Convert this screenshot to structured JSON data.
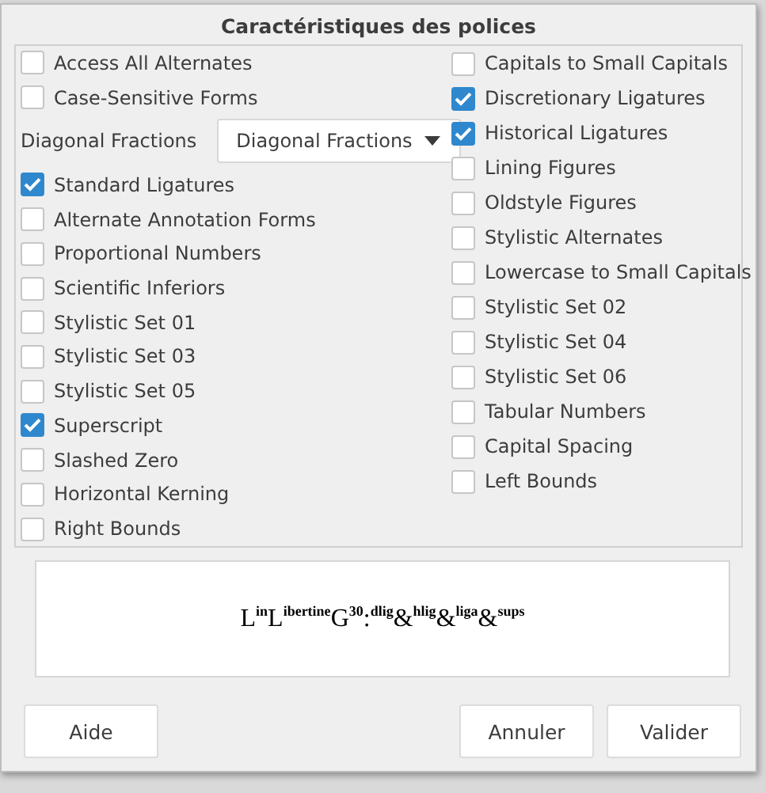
{
  "dialog": {
    "title": "Caractéristiques des polices"
  },
  "left_column": [
    {
      "kind": "checkbox",
      "label": "Access All Alternates",
      "checked": false
    },
    {
      "kind": "checkbox",
      "label": "Case-Sensitive Forms",
      "checked": false
    },
    {
      "kind": "dropdown",
      "label": "Diagonal Fractions",
      "value": "Diagonal Fractions"
    },
    {
      "kind": "checkbox",
      "label": "Standard Ligatures",
      "checked": true
    },
    {
      "kind": "checkbox",
      "label": "Alternate Annotation Forms",
      "checked": false
    },
    {
      "kind": "checkbox",
      "label": "Proportional Numbers",
      "checked": false
    },
    {
      "kind": "checkbox",
      "label": "Scientific Inferiors",
      "checked": false
    },
    {
      "kind": "checkbox",
      "label": "Stylistic Set 01",
      "checked": false
    },
    {
      "kind": "checkbox",
      "label": "Stylistic Set 03",
      "checked": false
    },
    {
      "kind": "checkbox",
      "label": "Stylistic Set 05",
      "checked": false
    },
    {
      "kind": "checkbox",
      "label": "Superscript",
      "checked": true
    },
    {
      "kind": "checkbox",
      "label": "Slashed Zero",
      "checked": false
    },
    {
      "kind": "checkbox",
      "label": "Horizontal Kerning",
      "checked": false
    },
    {
      "kind": "checkbox",
      "label": "Right Bounds",
      "checked": false
    }
  ],
  "right_column": [
    {
      "kind": "checkbox",
      "label": "Capitals to Small Capitals",
      "checked": false
    },
    {
      "kind": "checkbox",
      "label": "Discretionary Ligatures",
      "checked": true
    },
    {
      "kind": "checkbox",
      "label": "Historical Ligatures",
      "checked": true
    },
    {
      "kind": "checkbox",
      "label": "Lining Figures",
      "checked": false
    },
    {
      "kind": "checkbox",
      "label": "Oldstyle Figures",
      "checked": false
    },
    {
      "kind": "checkbox",
      "label": "Stylistic Alternates",
      "checked": false
    },
    {
      "kind": "checkbox",
      "label": "Lowercase to Small Capitals",
      "checked": false
    },
    {
      "kind": "checkbox",
      "label": "Stylistic Set 02",
      "checked": false
    },
    {
      "kind": "checkbox",
      "label": "Stylistic Set 04",
      "checked": false
    },
    {
      "kind": "checkbox",
      "label": "Stylistic Set 06",
      "checked": false
    },
    {
      "kind": "checkbox",
      "label": "Tabular Numbers",
      "checked": false
    },
    {
      "kind": "checkbox",
      "label": "Capital Spacing",
      "checked": false
    },
    {
      "kind": "checkbox",
      "label": "Left Bounds",
      "checked": false
    }
  ],
  "preview": {
    "text": "L$^{in}$L$^{ibertine}$G$^{30}$:$^{dlig}$&$^{hlig}$&$^{liga}$&$^{sups}$"
  },
  "left_buttons": [
    "Aide"
  ],
  "right_buttons": [
    "Annuler",
    "Valider"
  ]
}
